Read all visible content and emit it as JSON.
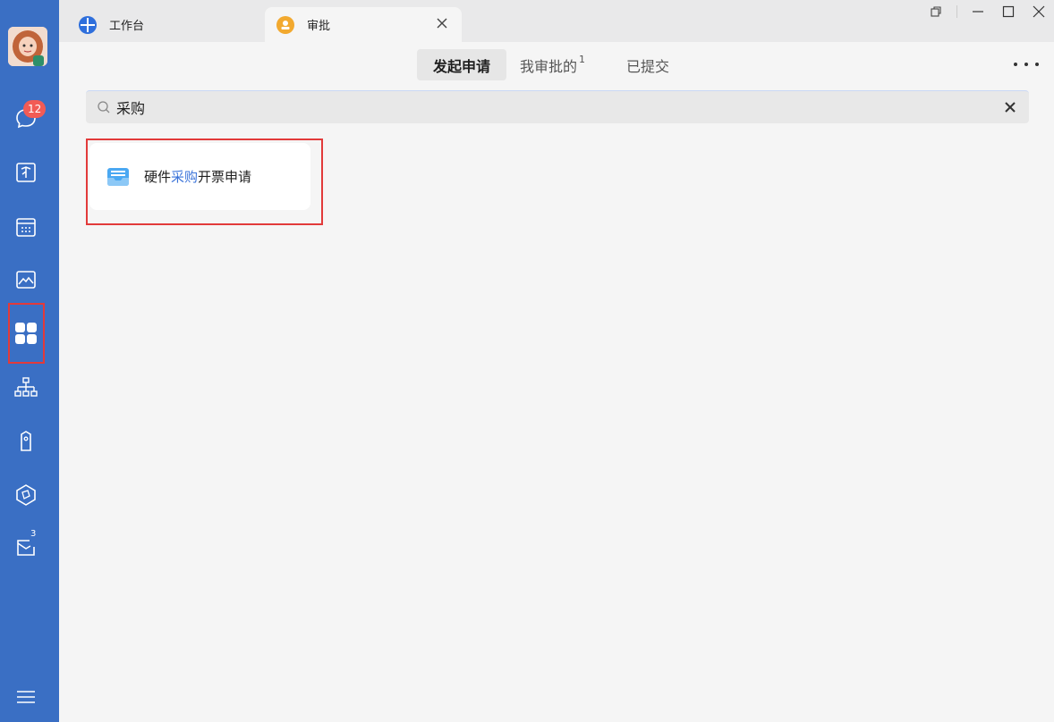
{
  "sidebar": {
    "messages_badge": "12",
    "mail_badge": "3",
    "items": [
      {
        "name": "messages"
      },
      {
        "name": "docs"
      },
      {
        "name": "calendar"
      },
      {
        "name": "gallery"
      },
      {
        "name": "workbench"
      },
      {
        "name": "org-chart"
      },
      {
        "name": "tag"
      },
      {
        "name": "cube"
      },
      {
        "name": "mail"
      }
    ],
    "accent": "#3a6fc4"
  },
  "tabs": [
    {
      "label": "工作台",
      "icon": "workbench-globe-icon",
      "color": "#2f6fdc"
    },
    {
      "label": "审批",
      "icon": "approval-person-icon",
      "color": "#f2a92f",
      "active": true
    }
  ],
  "segments": {
    "initiate": "发起申请",
    "my_approvals": "我审批的",
    "my_approvals_count": "1",
    "submitted": "已提交"
  },
  "search": {
    "value": "采购",
    "placeholder": ""
  },
  "result": {
    "prefix": "硬件",
    "highlight": "采购",
    "suffix": "开票申请",
    "icon": "inbox-tray-icon",
    "highlight_color": "#3a73d9"
  }
}
